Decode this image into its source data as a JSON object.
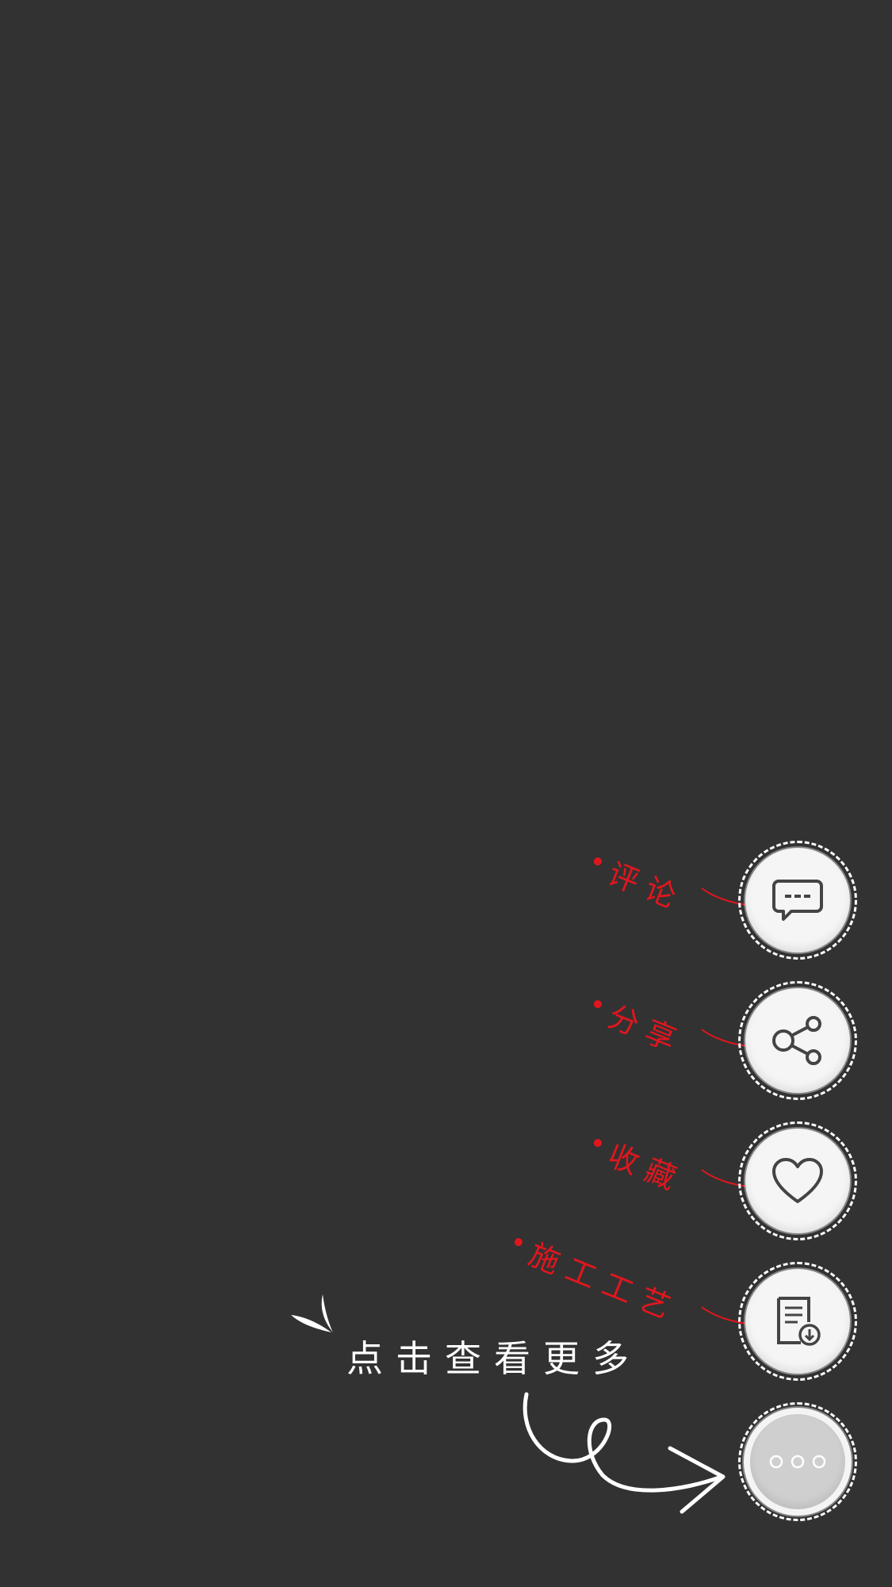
{
  "actions": {
    "comment": {
      "label": "评论",
      "icon": "comment-icon"
    },
    "share": {
      "label": "分享",
      "icon": "share-icon"
    },
    "favorite": {
      "label": "收藏",
      "icon": "heart-icon"
    },
    "process": {
      "label": "施工工艺",
      "icon": "document-download-icon"
    },
    "more": {
      "icon": "more-dots-icon"
    }
  },
  "hint": {
    "text": "点击查看更多"
  },
  "colors": {
    "background": "#323232",
    "accent": "#e0161e",
    "button": "#f5f5f5",
    "more_button": "#cfcfcf"
  }
}
